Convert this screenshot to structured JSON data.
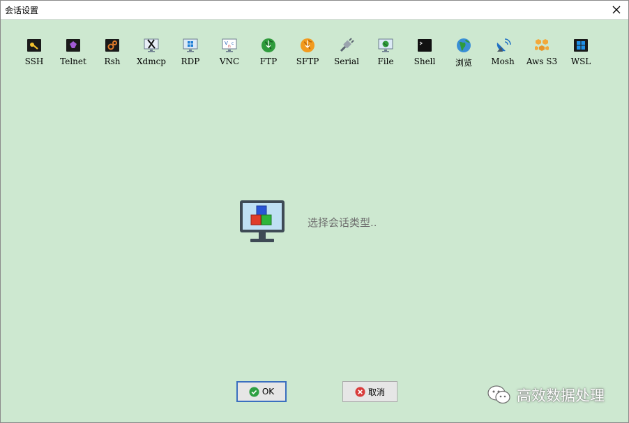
{
  "window": {
    "title": "会话设置"
  },
  "toolbar": {
    "items": [
      {
        "label": "SSH",
        "icon": "ssh-key-icon"
      },
      {
        "label": "Telnet",
        "icon": "telnet-icon"
      },
      {
        "label": "Rsh",
        "icon": "rsh-gears-icon"
      },
      {
        "label": "Xdmcp",
        "icon": "xdmcp-x-icon"
      },
      {
        "label": "RDP",
        "icon": "rdp-windows-monitor-icon"
      },
      {
        "label": "VNC",
        "icon": "vnc-monitor-icon"
      },
      {
        "label": "FTP",
        "icon": "ftp-globe-icon"
      },
      {
        "label": "SFTP",
        "icon": "sftp-globe-icon"
      },
      {
        "label": "Serial",
        "icon": "serial-plug-icon"
      },
      {
        "label": "File",
        "icon": "file-monitor-icon"
      },
      {
        "label": "Shell",
        "icon": "shell-terminal-icon"
      },
      {
        "label": "浏览",
        "icon": "browser-globe-icon"
      },
      {
        "label": "Mosh",
        "icon": "mosh-satellite-icon"
      },
      {
        "label": "Aws S3",
        "icon": "aws-s3-cubes-icon"
      },
      {
        "label": "WSL",
        "icon": "wsl-windows-icon"
      }
    ]
  },
  "main": {
    "hint": "选择会话类型.."
  },
  "buttons": {
    "ok": "OK",
    "cancel": "取消"
  },
  "watermark": {
    "text": "高效数据处理"
  },
  "colors": {
    "background": "#cde8d0",
    "ok_border": "#3a6fbf",
    "ok_icon": "#2ea043",
    "cancel_icon": "#d93c3c"
  }
}
